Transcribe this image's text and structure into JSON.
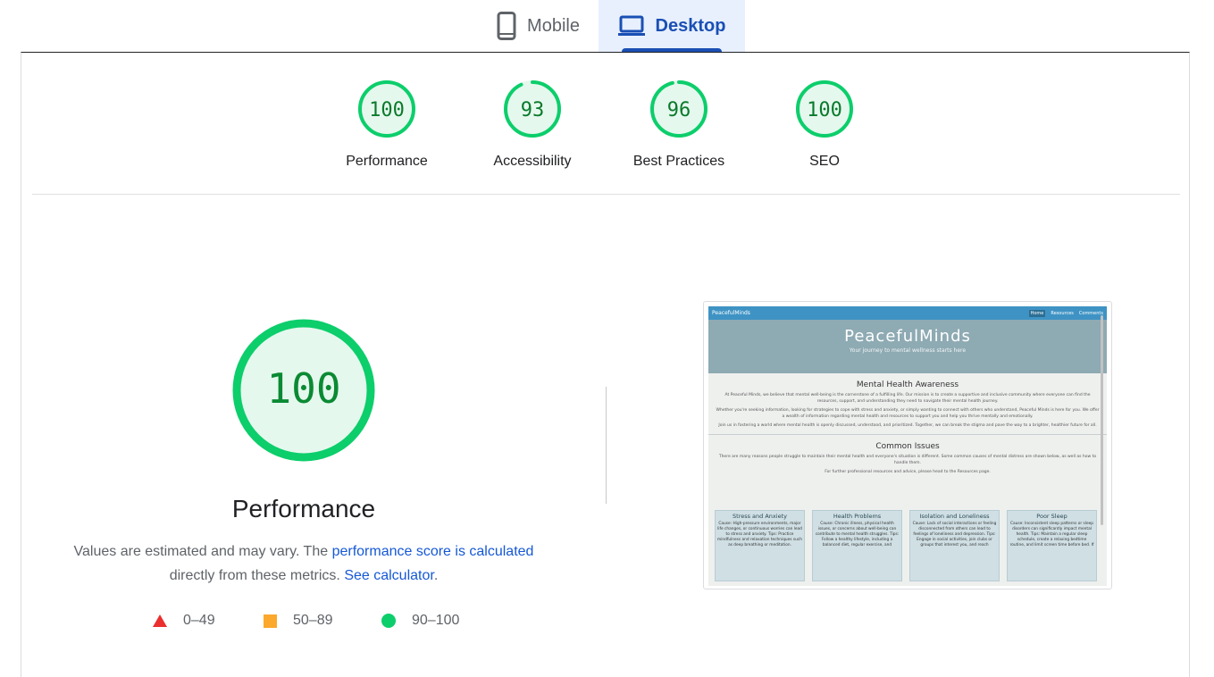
{
  "tabs": [
    {
      "label": "Mobile",
      "icon": "smartphone-icon",
      "active": false
    },
    {
      "label": "Desktop",
      "icon": "laptop-icon",
      "active": true
    }
  ],
  "categories": [
    {
      "label": "Performance",
      "score": "100",
      "value": 100
    },
    {
      "label": "Accessibility",
      "score": "93",
      "value": 93
    },
    {
      "label": "Best Practices",
      "score": "96",
      "value": 96
    },
    {
      "label": "SEO",
      "score": "100",
      "value": 100
    }
  ],
  "main": {
    "score": "100",
    "value": 100,
    "title": "Performance",
    "desc_part1": "Values are estimated and may vary. The ",
    "desc_link1": "performance score is calculated",
    "desc_part2": " directly from these metrics. ",
    "desc_link2": "See calculator",
    "desc_part3": "."
  },
  "legend": [
    {
      "range": "0–49",
      "shape": "triangle",
      "color": "#eb2e2e"
    },
    {
      "range": "50–89",
      "shape": "square",
      "color": "#fba82c"
    },
    {
      "range": "90–100",
      "shape": "circle",
      "color": "#0cce6b"
    }
  ],
  "colors": {
    "pass": "#0cce6b",
    "pass_bg": "#e5f8ee",
    "pass_text": "#0a7a2b",
    "active_tab": "#1a4fb4",
    "link": "#1558d6"
  },
  "screenshot": {
    "brand": "PeacefulMinds",
    "nav_links": [
      "Home",
      "Resources",
      "Comments"
    ],
    "hero_title": "PeacefulMinds",
    "hero_sub": "Your journey to mental wellness starts here",
    "section1_title": "Mental Health Awareness",
    "section1_p1": "At Peaceful Minds, we believe that mental well-being is the cornerstone of a fulfilling life. Our mission is to create a supportive and inclusive community where everyone can find the resources, support, and understanding they need to navigate their mental health journey.",
    "section1_p2": "Whether you're seeking information, looking for strategies to cope with stress and anxiety, or simply wanting to connect with others who understand, Peaceful Minds is here for you. We offer a wealth of information regarding mental health and resources to support you and help you thrive mentally and emotionally.",
    "section1_p3": "Join us in fostering a world where mental health is openly discussed, understood, and prioritized. Together, we can break the stigma and pave the way to a brighter, healthier future for all.",
    "section2_title": "Common Issues",
    "section2_p1": "There are many reasons people struggle to maintain their mental health and everyone's situation is different. Some common causes of mental distress are shown below, as well as how to handle them.",
    "section2_p2": "For further professional resources and advice, please head to the Resources page.",
    "cards": [
      {
        "title": "Stress and Anxiety",
        "body": "Cause: High-pressure environments, major life changes, or continuous worries can lead to stress and anxiety. Tips: Practice mindfulness and relaxation techniques such as deep breathing or meditation."
      },
      {
        "title": "Health Problems",
        "body": "Cause: Chronic illness, physical health issues, or concerns about well-being can contribute to mental health struggles. Tips: Follow a healthy lifestyle, including a balanced diet, regular exercise, and"
      },
      {
        "title": "Isolation and Loneliness",
        "body": "Cause: Lack of social interactions or feeling disconnected from others can lead to feelings of loneliness and depression. Tips: Engage in social activities, join clubs or groups that interest you, and reach"
      },
      {
        "title": "Poor Sleep",
        "body": "Cause: Inconsistent sleep patterns or sleep disorders can significantly impact mental health. Tips: Maintain a regular sleep schedule, create a relaxing bedtime routine, and limit screen time before bed. If"
      }
    ]
  }
}
